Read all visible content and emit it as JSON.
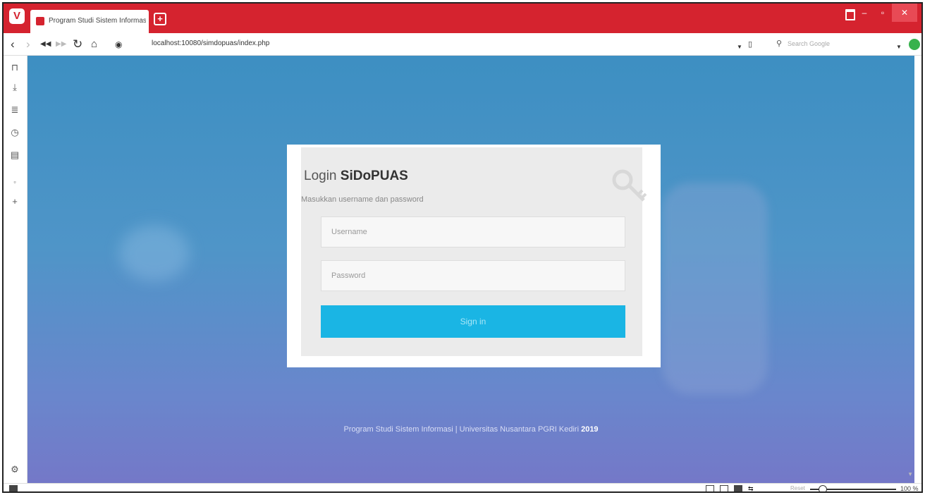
{
  "browser": {
    "tab_title": "Program Studi Sistem Informasi",
    "url": "localhost:10080/simdopuas/index.php",
    "search_placeholder": "Search Google",
    "zoom_label": "Reset",
    "zoom_value": "100 %"
  },
  "login": {
    "title_prefix": "Login ",
    "title_brand": "SiDoPUAS",
    "subtitle": "Masukkan username dan password",
    "username_placeholder": "Username",
    "password_placeholder": "Password",
    "signin_label": "Sign in"
  },
  "footer": {
    "text": "Program Studi Sistem Informasi | Universitas Nusantara PGRI Kediri ",
    "year": "2019"
  }
}
